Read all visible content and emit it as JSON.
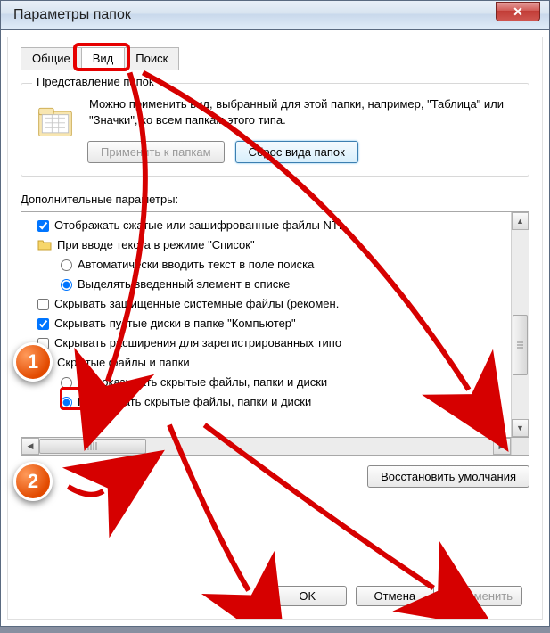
{
  "window": {
    "title": "Параметры папок",
    "close_glyph": "✕"
  },
  "tabs": {
    "general": "Общие",
    "view": "Вид",
    "search": "Поиск"
  },
  "folder_views": {
    "group_title": "Представление папок",
    "description": "Можно применить вид, выбранный для этой папки, например, \"Таблица\" или \"Значки\", ко всем папкам этого типа.",
    "apply_btn": "Применить к папкам",
    "reset_btn": "Сброс вида папок"
  },
  "advanced": {
    "label": "Дополнительные параметры:",
    "items": [
      {
        "type": "checkbox",
        "checked": true,
        "text": "Отображать сжатые или зашифрованные файлы NTI"
      },
      {
        "type": "folder",
        "text": "При вводе текста в режиме \"Список\""
      },
      {
        "type": "radio",
        "checked": false,
        "indent": true,
        "text": "Автоматически вводить текст в поле поиска"
      },
      {
        "type": "radio",
        "checked": true,
        "indent": true,
        "text": "Выделять введенный элемент в списке"
      },
      {
        "type": "checkbox",
        "checked": false,
        "text": "Скрывать защищенные системные файлы (рекомен."
      },
      {
        "type": "checkbox",
        "checked": true,
        "text": "Скрывать пустые диски в папке \"Компьютер\""
      },
      {
        "type": "checkbox",
        "checked": false,
        "text": "Скрывать расширения для зарегистрированных типо"
      },
      {
        "type": "folder",
        "text": "Скрытые файлы и папки"
      },
      {
        "type": "radio",
        "checked": false,
        "indent": true,
        "text": "Не показывать скрытые файлы, папки и диски"
      },
      {
        "type": "radio",
        "checked": true,
        "indent": true,
        "text": "Показывать скрытые файлы, папки и диски"
      }
    ],
    "restore_btn": "Восстановить умолчания"
  },
  "buttons": {
    "ok": "OK",
    "cancel": "Отмена",
    "apply": "Применить"
  },
  "annotations": {
    "badge1": "1",
    "badge2": "2"
  }
}
